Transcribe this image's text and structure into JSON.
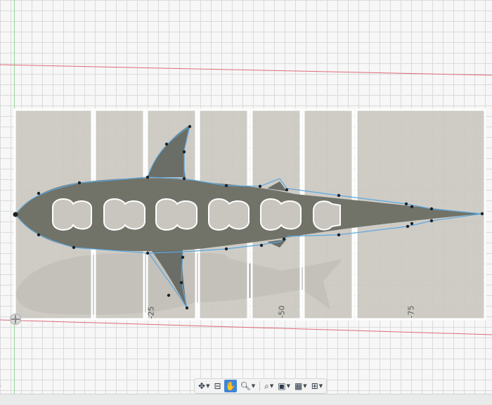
{
  "canvas": {
    "dimension_labels": [
      "-25",
      "-50",
      "-75"
    ],
    "colors": {
      "sketch_profile": "#5aa8e0",
      "construction_line": "#e06a7a",
      "panel_fill": "#c9c6bf",
      "shark_body": "#6d6f68",
      "shadow": "#8a8a86"
    }
  },
  "toolbar": {
    "buttons": [
      {
        "name": "orbit-tool",
        "icon": "orbit-icon",
        "has_menu": true,
        "active": false
      },
      {
        "name": "look-at-tool",
        "icon": "look-at-icon",
        "has_menu": false,
        "active": false
      },
      {
        "name": "pan-tool",
        "icon": "hand-icon",
        "has_menu": false,
        "active": true
      },
      {
        "name": "zoom-tool",
        "icon": "zoom-icon",
        "has_menu": true,
        "active": false
      },
      {
        "name": "fit-tool",
        "icon": "zoom-window-icon",
        "has_menu": true,
        "active": false
      },
      {
        "name": "display-settings",
        "icon": "display-icon",
        "has_menu": true,
        "active": false
      },
      {
        "name": "grid-settings",
        "icon": "grid-icon",
        "has_menu": true,
        "active": false
      },
      {
        "name": "viewports",
        "icon": "viewports-icon",
        "has_menu": true,
        "active": false
      }
    ]
  }
}
